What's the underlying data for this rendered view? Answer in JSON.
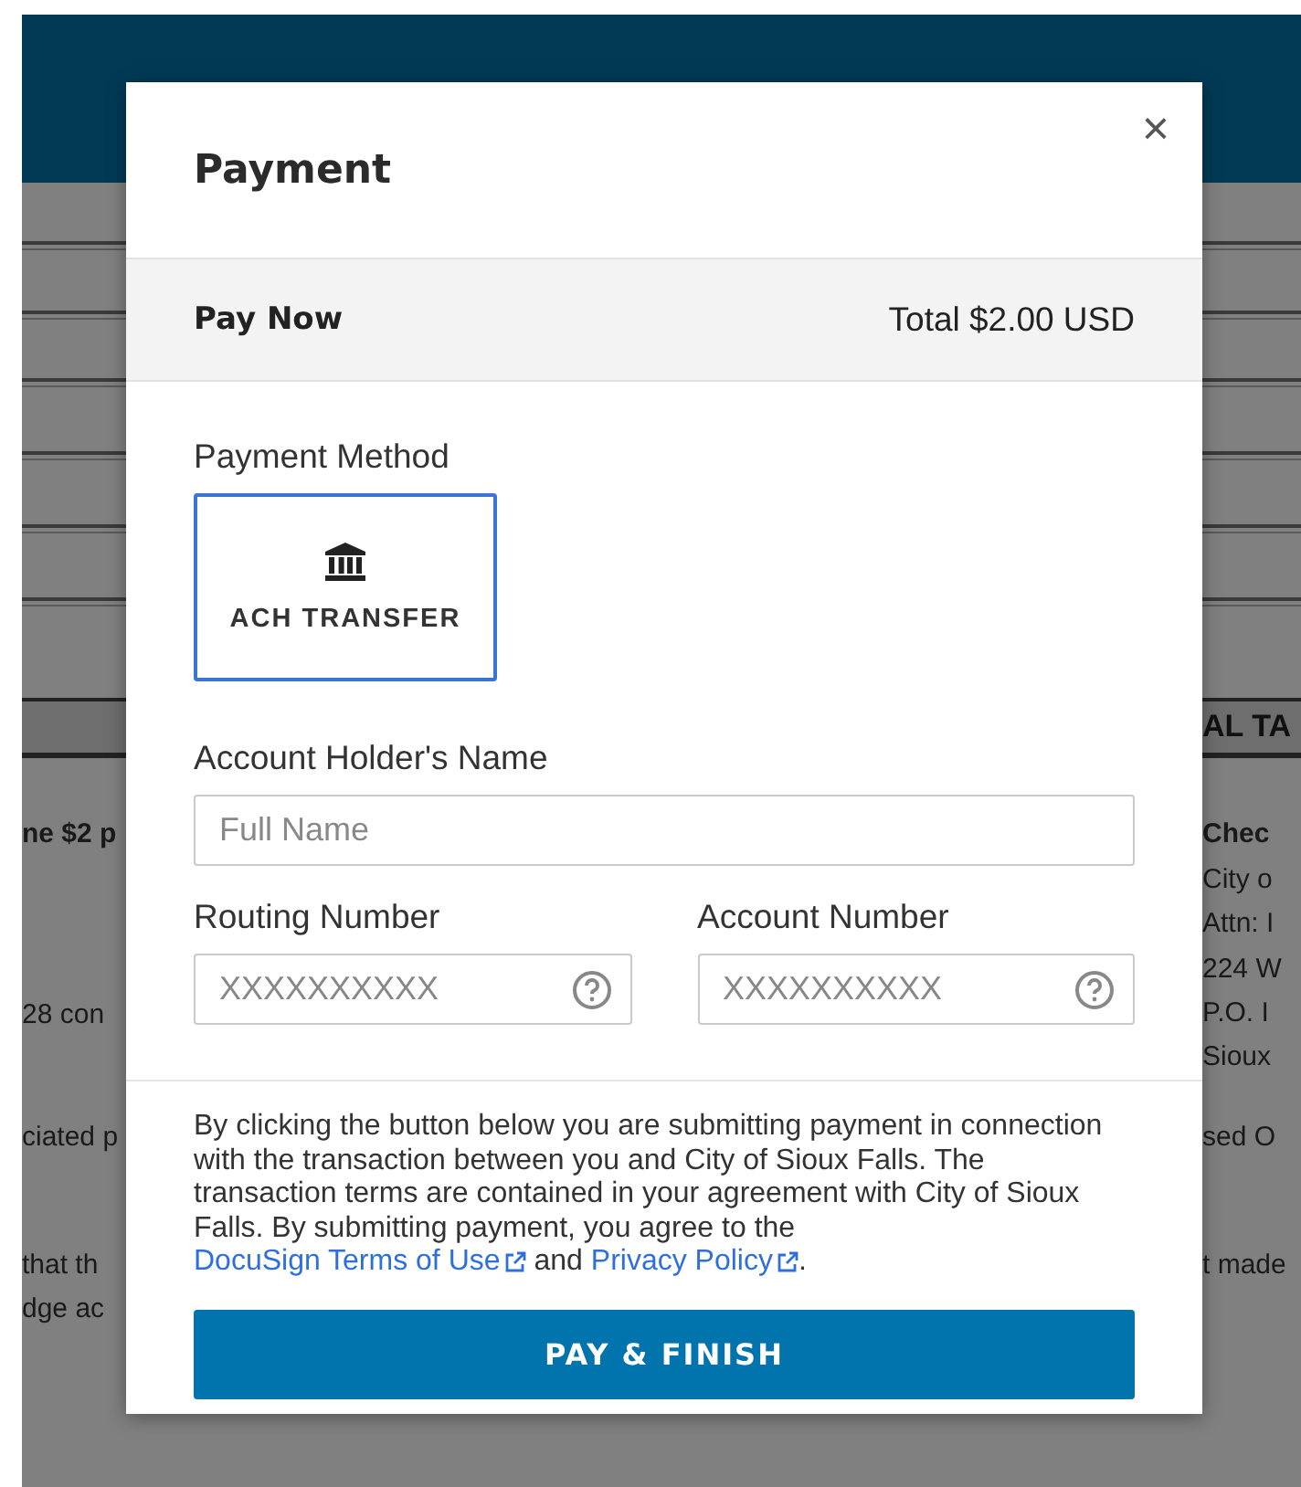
{
  "background_document": {
    "left_fragments": [
      {
        "text": "ne $2 p",
        "bold": true
      },
      {
        "text": "28 con",
        "bold": false
      },
      {
        "text": "ciated p",
        "bold": false
      },
      {
        "text": "that th",
        "bold": false
      },
      {
        "text": "dge ac",
        "bold": false
      }
    ],
    "right_heading": "AL TA",
    "right_fragments": [
      {
        "text": "Chec",
        "bold": true
      },
      {
        "text": "City o",
        "bold": false
      },
      {
        "text": "Attn: I",
        "bold": false
      },
      {
        "text": "224 W",
        "bold": false
      },
      {
        "text": "P.O. I",
        "bold": false
      },
      {
        "text": "Sioux",
        "bold": false
      },
      {
        "text": "sed O",
        "bold": false
      },
      {
        "text": "t made",
        "bold": false
      }
    ]
  },
  "dialog": {
    "title": "Payment",
    "close": "×",
    "summary": {
      "label": "Pay Now",
      "total": "Total $2.00 USD"
    },
    "payment_method_label": "Payment Method",
    "payment_methods": [
      {
        "label": "ACH TRANSFER",
        "selected": true
      }
    ],
    "fields": [
      {
        "label": "Account Holder's Name",
        "placeholder": "Full Name",
        "help": false
      },
      {
        "label": "Routing Number",
        "placeholder": "XXXXXXXXXX",
        "help": true
      },
      {
        "label": "Account Number",
        "placeholder": "XXXXXXXXXX",
        "help": true
      }
    ],
    "disclaimer": "By clicking the button below you are submitting payment in connection with the transaction between you and City of Sioux Falls. The transaction terms are contained in your agreement with City of Sioux Falls. By submitting payment, you agree to the",
    "links": [
      {
        "text": "DocuSign Terms of Use"
      },
      {
        "text": "Privacy Policy"
      }
    ],
    "link_joiner": "and",
    "end_punctuation": ".",
    "submit": "PAY & FINISH"
  }
}
